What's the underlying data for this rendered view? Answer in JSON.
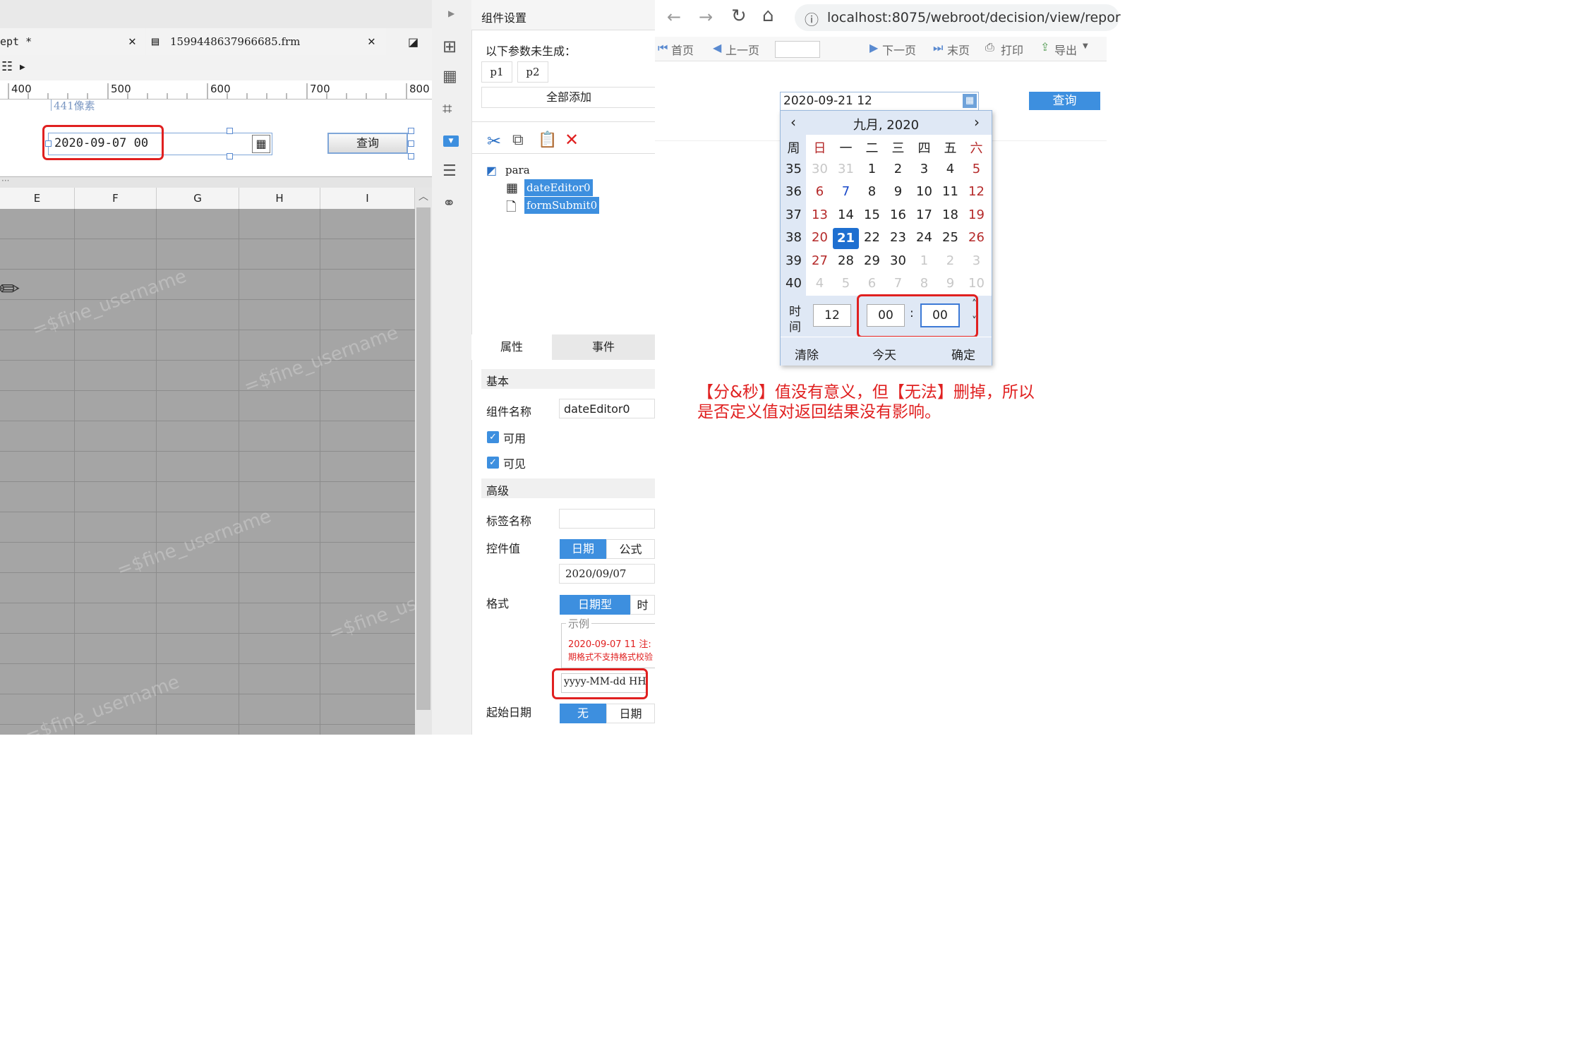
{
  "designer": {
    "tab1": "ept *",
    "tab2": "1599448637966685.frm",
    "ruler": [
      "400",
      "500",
      "600",
      "700",
      "800"
    ],
    "pixel_label": "441像素",
    "date_value": "2020-09-07 00",
    "query_label": "查询",
    "columns": [
      "E",
      "F",
      "G",
      "H",
      "I"
    ],
    "watermark": "=$fine_username"
  },
  "panel": {
    "title": "组件设置",
    "params_title": "以下参数未生成：",
    "params": [
      "p1",
      "p2"
    ],
    "add_all": "全部添加",
    "tree_root": "para",
    "tree_items": [
      "dateEditor0",
      "formSubmit0"
    ],
    "tabs": [
      "属性",
      "事件"
    ],
    "basic": "基本",
    "name_label": "组件名称",
    "name_value": "dateEditor0",
    "enabled": "可用",
    "visible": "可见",
    "advanced": "高级",
    "tag_label": "标签名称",
    "control_value_label": "控件值",
    "value_types": [
      "日期",
      "公式"
    ],
    "value": "2020/09/07",
    "format_label": "格式",
    "format_types": [
      "日期型",
      "时"
    ],
    "example_title": "示例",
    "example_line1": "2020-09-07 11 注:",
    "example_line2": "期格式不支持格式校验",
    "format_value": "yyyy-MM-dd HH",
    "start_label": "起始日期",
    "start_types": [
      "无",
      "日期"
    ]
  },
  "browser": {
    "url": "localhost:8075/webroot/decision/view/repor",
    "toolbar": [
      "首页",
      "上一页",
      "下一页",
      "末页",
      "打印",
      "导出"
    ],
    "date_value": "2020-09-21 12",
    "query_label": "查询",
    "calendar": {
      "title": "九月, 2020",
      "weekdays": [
        "周",
        "日",
        "一",
        "二",
        "三",
        "四",
        "五",
        "六"
      ],
      "rows": [
        [
          "35",
          "30",
          "31",
          "1",
          "2",
          "3",
          "4",
          "5"
        ],
        [
          "36",
          "6",
          "7",
          "8",
          "9",
          "10",
          "11",
          "12"
        ],
        [
          "37",
          "13",
          "14",
          "15",
          "16",
          "17",
          "18",
          "19"
        ],
        [
          "38",
          "20",
          "21",
          "22",
          "23",
          "24",
          "25",
          "26"
        ],
        [
          "39",
          "27",
          "28",
          "29",
          "30",
          "1",
          "2",
          "3"
        ],
        [
          "40",
          "4",
          "5",
          "6",
          "7",
          "8",
          "9",
          "10"
        ]
      ],
      "time_label_1": "时",
      "time_label_2": "间",
      "hour": "12",
      "minute": "00",
      "second": "00",
      "clear": "清除",
      "today": "今天",
      "ok": "确定"
    },
    "note_line1": "【分&秒】值没有意义，但【无法】删掉，所以",
    "note_line2": "是否定义值对返回结果没有影响。"
  },
  "colors": {
    "accent": "#3d8fdf",
    "annotation": "#e02020",
    "selected_day": "#1e6fd0"
  }
}
